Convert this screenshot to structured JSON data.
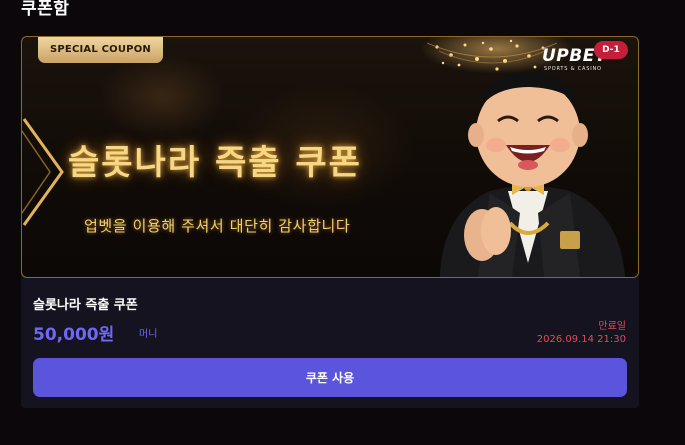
{
  "page": {
    "title": "쿠폰함"
  },
  "coupon": {
    "banner": {
      "badge": "SPECIAL COUPON",
      "brand_main": "UPBET",
      "brand_sub": "SPORTS & CASINO",
      "d_day": "D-1",
      "headline": "슬롯나라 즉출 쿠폰",
      "subline": "업벳을 이용해 주셔서 대단히 감사합니다"
    },
    "name": "슬롯나라 즉출 쿠폰",
    "amount": "50,000원",
    "amount_unit": "머니",
    "expiry_label": "만료일",
    "expiry_date": "2026.09.14 21:30",
    "use_button_label": "쿠폰 사용"
  },
  "colors": {
    "page_bg": "#0b070b",
    "card_bg": "#14131f",
    "accent": "#5b55de",
    "amount": "#6f68f2",
    "expiry": "#e24a5a",
    "gold": "#f6d786",
    "d_day_badge": "#c41e3a"
  },
  "icons": [
    "chevron-right-decoration",
    "chandelier-decoration",
    "mascot-illustration"
  ]
}
